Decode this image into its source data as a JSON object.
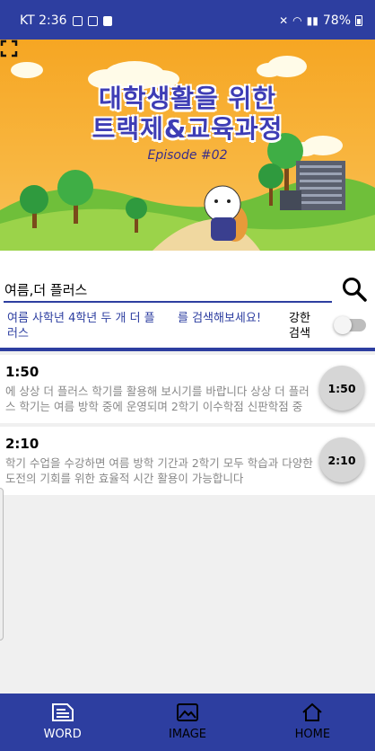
{
  "status_bar": {
    "carrier_time": "KT 2:36",
    "battery": "78%"
  },
  "banner": {
    "title_line1": "대학생활을 위한",
    "title_line2": "트랙제&교육과정",
    "episode": "Episode #02"
  },
  "search": {
    "query": "여름,더 플러스",
    "hint_query": "여름 사학년 4학년 두 개 더 플러스",
    "hint_suffix": "를 검색해보세요!",
    "strong_search_label": "강한 검색",
    "strong_search_enabled": false
  },
  "results": [
    {
      "time": "1:50",
      "text": " 에 상상 더 플러스 학기를 활용해 보시기를 바랍니다 상상 더 플러스 학기는 여름 방학 중에 운영되며 2학기 이수학점 신판학점 중",
      "button": "1:50"
    },
    {
      "time": "2:10",
      "text": " 학기 수업을 수강하면 여름 방학 기간과 2학기 모두 학습과 다양한 도전의 기회를 위한 효율적 시간 활용이 가능합니다",
      "button": "2:10"
    }
  ],
  "bottom_nav": [
    {
      "label": "WORD",
      "icon": "document-icon",
      "active": true
    },
    {
      "label": "IMAGE",
      "icon": "image-icon",
      "active": false
    },
    {
      "label": "HOME",
      "icon": "home-icon",
      "active": false
    }
  ],
  "colors": {
    "primary": "#2d3ea0",
    "banner_orange": "#f6a623"
  }
}
